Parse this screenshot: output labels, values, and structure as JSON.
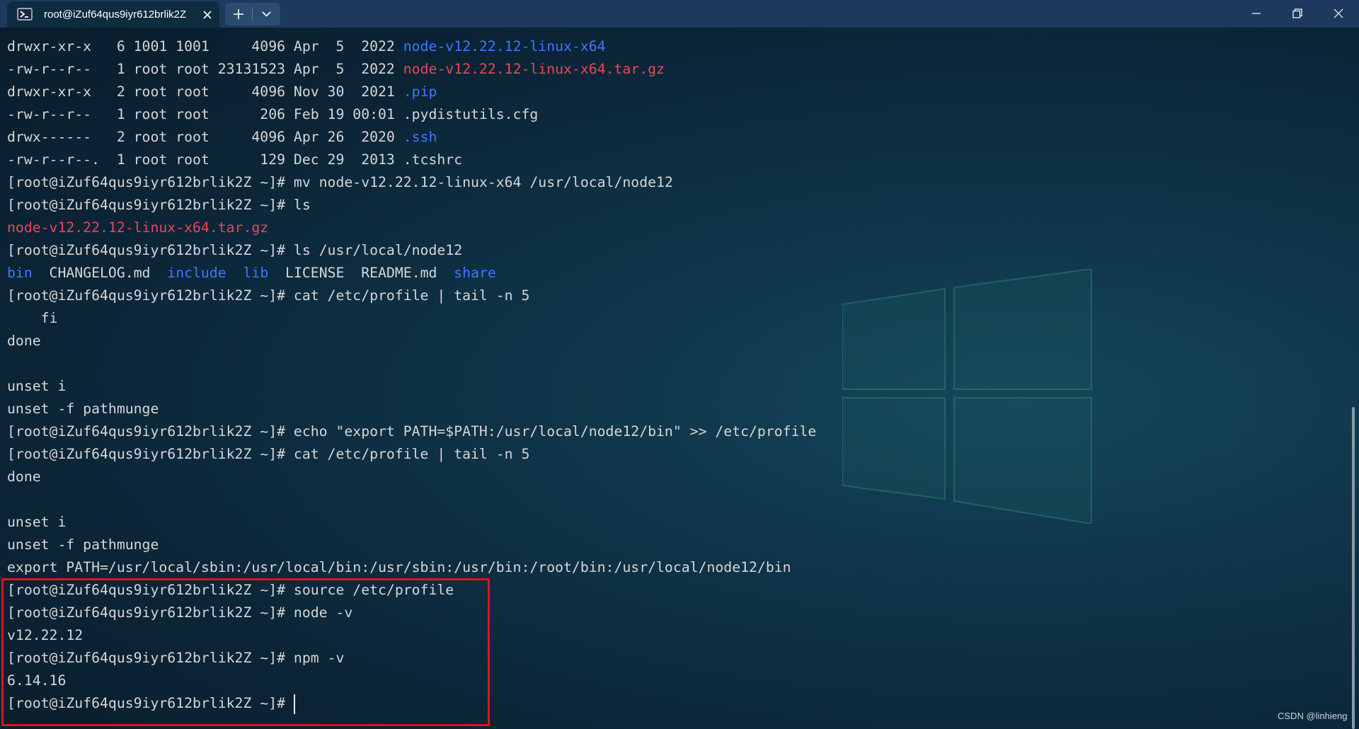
{
  "window": {
    "tab_title": "root@iZuf64qus9iyr612brlik2Z",
    "icons": {
      "tab": "terminal-prompt-icon",
      "close_tab": "close-icon",
      "new_tab": "plus-icon",
      "dropdown": "chevron-down-icon",
      "minimize": "minimize-icon",
      "maximize": "restore-icon",
      "close": "close-icon"
    }
  },
  "colors": {
    "titlebar": "#1d3a5e",
    "tab": "#0e2c40",
    "text": "#d6d6d6",
    "directory": "#3b78ff",
    "archive": "#e74856",
    "highlight": "#e0121c"
  },
  "terminal": {
    "lines": [
      [
        {
          "t": "drwxr-xr-x   6 1001 1001     4096 Apr  5  2022 "
        },
        {
          "t": "node-v12.22.12-linux-x64",
          "c": "blue"
        }
      ],
      [
        {
          "t": "-rw-r--r--   1 root root 23131523 Apr  5  2022 "
        },
        {
          "t": "node-v12.22.12-linux-x64.tar.gz",
          "c": "red"
        }
      ],
      [
        {
          "t": "drwxr-xr-x   2 root root     4096 Nov 30  2021 "
        },
        {
          "t": ".pip",
          "c": "blue"
        }
      ],
      [
        {
          "t": "-rw-r--r--   1 root root      206 Feb 19 00:01 .pydistutils.cfg"
        }
      ],
      [
        {
          "t": "drwx------   2 root root     4096 Apr 26  2020 "
        },
        {
          "t": ".ssh",
          "c": "blue"
        }
      ],
      [
        {
          "t": "-rw-r--r--.  1 root root      129 Dec 29  2013 .tcshrc"
        }
      ],
      [
        {
          "t": "[root@iZuf64qus9iyr612brlik2Z ~]# mv node-v12.22.12-linux-x64 /usr/local/node12"
        }
      ],
      [
        {
          "t": "[root@iZuf64qus9iyr612brlik2Z ~]# ls"
        }
      ],
      [
        {
          "t": "node-v12.22.12-linux-x64.tar.gz",
          "c": "red"
        }
      ],
      [
        {
          "t": "[root@iZuf64qus9iyr612brlik2Z ~]# ls /usr/local/node12"
        }
      ],
      [
        {
          "t": "bin",
          "c": "blue"
        },
        {
          "t": "  CHANGELOG.md  "
        },
        {
          "t": "include",
          "c": "blue"
        },
        {
          "t": "  "
        },
        {
          "t": "lib",
          "c": "blue"
        },
        {
          "t": "  LICENSE  README.md  "
        },
        {
          "t": "share",
          "c": "blue"
        }
      ],
      [
        {
          "t": "[root@iZuf64qus9iyr612brlik2Z ~]# cat /etc/profile | tail -n 5"
        }
      ],
      [
        {
          "t": "    fi"
        }
      ],
      [
        {
          "t": "done"
        }
      ],
      [
        {
          "t": ""
        }
      ],
      [
        {
          "t": "unset i"
        }
      ],
      [
        {
          "t": "unset -f pathmunge"
        }
      ],
      [
        {
          "t": "[root@iZuf64qus9iyr612brlik2Z ~]# echo \"export PATH=$PATH:/usr/local/node12/bin\" >> /etc/profile"
        }
      ],
      [
        {
          "t": "[root@iZuf64qus9iyr612brlik2Z ~]# cat /etc/profile | tail -n 5"
        }
      ],
      [
        {
          "t": "done"
        }
      ],
      [
        {
          "t": ""
        }
      ],
      [
        {
          "t": "unset i"
        }
      ],
      [
        {
          "t": "unset -f pathmunge"
        }
      ],
      [
        {
          "t": "export PATH=/usr/local/sbin:/usr/local/bin:/usr/sbin:/usr/bin:/root/bin:/usr/local/node12/bin"
        }
      ],
      [
        {
          "t": "[root@iZuf64qus9iyr612brlik2Z ~]# source /etc/profile"
        }
      ],
      [
        {
          "t": "[root@iZuf64qus9iyr612brlik2Z ~]# node -v"
        }
      ],
      [
        {
          "t": "v12.22.12"
        }
      ],
      [
        {
          "t": "[root@iZuf64qus9iyr612brlik2Z ~]# npm -v"
        }
      ],
      [
        {
          "t": "6.14.16"
        }
      ],
      [
        {
          "t": "[root@iZuf64qus9iyr612brlik2Z ~]# "
        }
      ]
    ]
  },
  "watermark": "CSDN @linhieng"
}
